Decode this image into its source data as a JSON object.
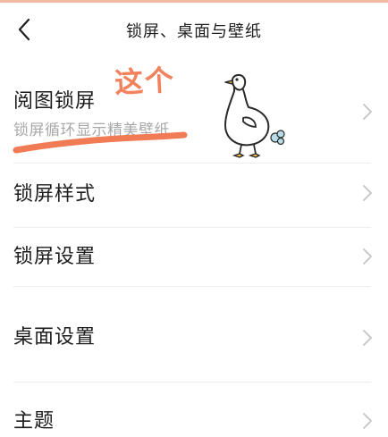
{
  "header": {
    "title": "锁屏、桌面与壁纸"
  },
  "annotation": {
    "text": "这个",
    "color": "#f2825e"
  },
  "rows": [
    {
      "label": "阅图锁屏",
      "sublabel": "锁屏循环显示精美壁纸"
    },
    {
      "label": "锁屏样式"
    },
    {
      "label": "锁屏设置"
    },
    {
      "label": "桌面设置"
    },
    {
      "label": "主题"
    }
  ],
  "icons": {
    "back": "back-arrow-icon",
    "chevron": "chevron-right-icon",
    "sticker": "goose-sticker"
  }
}
